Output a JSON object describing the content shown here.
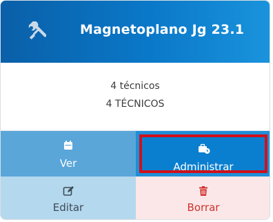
{
  "card": {
    "title": "Magnetoplano Jg 23.1",
    "header_icon": "tools-icon",
    "line1": "4 técnicos",
    "line2": "4 TÉCNICOS"
  },
  "actions": {
    "ver": {
      "label": "Ver",
      "icon": "calendar-icon"
    },
    "administrar": {
      "label": "Administrar",
      "icon": "briefcase-clock-icon"
    },
    "editar": {
      "label": "Editar",
      "icon": "edit-icon"
    },
    "borrar": {
      "label": "Borrar",
      "icon": "trash-icon"
    }
  },
  "colors": {
    "header_start": "#0a5fa8",
    "header_end": "#1a93dc",
    "highlight_border": "#d0101a",
    "delete_text": "#d0312d"
  }
}
